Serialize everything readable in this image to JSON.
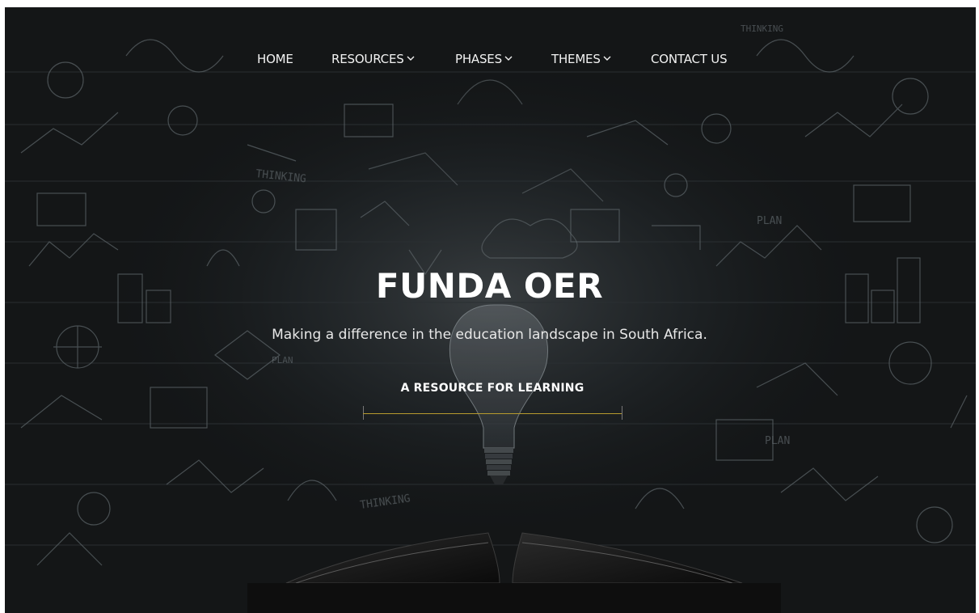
{
  "nav": {
    "items": [
      {
        "label": "HOME",
        "has_dropdown": false
      },
      {
        "label": "RESOURCES",
        "has_dropdown": true
      },
      {
        "label": "PHASES",
        "has_dropdown": true
      },
      {
        "label": "THEMES",
        "has_dropdown": true
      },
      {
        "label": "CONTACT US",
        "has_dropdown": false
      }
    ]
  },
  "hero": {
    "title": "FUNDA OER",
    "subtitle": "Making a difference in the education landscape in South Africa.",
    "cta_label": "A RESOURCE FOR LEARNING",
    "background_icons": [
      "chalkboard-doodles",
      "lightbulb-icon",
      "open-book"
    ],
    "chalk_words": [
      "THINKING",
      "PLAN",
      "THINKING",
      "PLAN",
      "PLAN",
      "THINKING"
    ]
  },
  "colors": {
    "background": "#141617",
    "text": "#ffffff",
    "cta_underline": "#b79a2e"
  }
}
